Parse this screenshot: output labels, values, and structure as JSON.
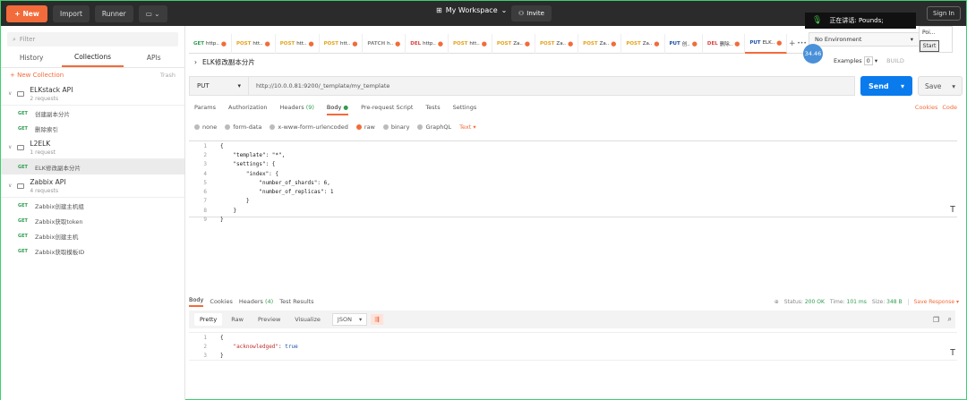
{
  "topbar": {
    "new_label": "New",
    "import_label": "Import",
    "runner_label": "Runner",
    "workspace_label": "My Workspace",
    "invite_label": "Invite",
    "signin_label": "Sign In",
    "voice_text": "正在讲话: Pounds;"
  },
  "sidebar": {
    "filter_placeholder": "Filter",
    "tabs": [
      "History",
      "Collections",
      "APIs"
    ],
    "new_collection": "+ New Collection",
    "trash": "Trash",
    "collections": [
      {
        "name": "ELKstack API",
        "count": "2 requests",
        "requests": [
          {
            "method": "GET",
            "name": "创建副本分片"
          },
          {
            "method": "GET",
            "name": "删除索引"
          }
        ]
      },
      {
        "name": "L2ELK",
        "count": "1 request",
        "requests": [
          {
            "method": "GET",
            "name": "ELK修改副本分片"
          }
        ]
      },
      {
        "name": "Zabbix API",
        "count": "4 requests",
        "requests": [
          {
            "method": "GET",
            "name": "Zabbix创建主机组"
          },
          {
            "method": "GET",
            "name": "Zabbix获取token"
          },
          {
            "method": "GET",
            "name": "Zabbix创建主机"
          },
          {
            "method": "GET",
            "name": "Zabbix获取模板ID"
          }
        ]
      }
    ]
  },
  "tabs": [
    {
      "method": "GET",
      "title": "http..",
      "color": "#2e9d4f"
    },
    {
      "method": "POST",
      "title": "htt..",
      "color": "#e5a11a"
    },
    {
      "method": "POST",
      "title": "htt..",
      "color": "#e5a11a"
    },
    {
      "method": "POST",
      "title": "htt..",
      "color": "#e5a11a"
    },
    {
      "method": "PATCH",
      "title": "h..",
      "color": "#888888"
    },
    {
      "method": "DEL",
      "title": "http..",
      "color": "#d93f3f"
    },
    {
      "method": "POST",
      "title": "htt..",
      "color": "#e5a11a"
    },
    {
      "method": "POST",
      "title": "Za..",
      "color": "#e5a11a"
    },
    {
      "method": "POST",
      "title": "Za..",
      "color": "#e5a11a"
    },
    {
      "method": "POST",
      "title": "Za..",
      "color": "#e5a11a"
    },
    {
      "method": "POST",
      "title": "Za..",
      "color": "#e5a11a"
    },
    {
      "method": "PUT",
      "title": "创..",
      "color": "#1a4fa8"
    },
    {
      "method": "DEL",
      "title": "删除..",
      "color": "#d93f3f"
    },
    {
      "method": "PUT",
      "title": "ELK..",
      "color": "#1a4fa8"
    }
  ],
  "env": {
    "label": "No Environment",
    "poi": "Poi...",
    "start": "Start",
    "timer": "34.46"
  },
  "request": {
    "title": "ELK修改副本分片",
    "examples": "Examples",
    "examples_count": "0",
    "build": "BUILD",
    "method": "PUT",
    "url": "http://10.0.0.81:9200/_template/my_template",
    "send": "Send",
    "save": "Save"
  },
  "req_tabs": {
    "params": "Params",
    "authorization": "Authorization",
    "headers": "Headers",
    "headers_count": "(9)",
    "body": "Body",
    "prerequest": "Pre-request Script",
    "tests": "Tests",
    "settings": "Settings",
    "cookies": "Cookies",
    "code": "Code"
  },
  "body_types": [
    "none",
    "form-data",
    "x-www-form-urlencoded",
    "raw",
    "binary",
    "GraphQL"
  ],
  "body_format": "Text",
  "request_body": [
    "{",
    "    \"template\": \"*\",",
    "    \"settings\": {",
    "        \"index\": {",
    "            \"number_of_shards\": 6,",
    "            \"number_of_replicas\": 1",
    "        }",
    "    }",
    "}"
  ],
  "response": {
    "tabs": {
      "body": "Body",
      "cookies": "Cookies",
      "headers": "Headers",
      "headers_count": "(4)",
      "tests": "Test Results"
    },
    "status_label": "Status:",
    "status": "200 OK",
    "time_label": "Time:",
    "time": "101 ms",
    "size_label": "Size:",
    "size": "348 B",
    "save_response": "Save Response",
    "views": [
      "Pretty",
      "Raw",
      "Preview",
      "Visualize"
    ],
    "format": "JSON",
    "lines": [
      {
        "key": "",
        "value": "{"
      },
      {
        "key": "\"acknowledged\"",
        "value": "true"
      },
      {
        "key": "",
        "value": "}"
      }
    ]
  }
}
